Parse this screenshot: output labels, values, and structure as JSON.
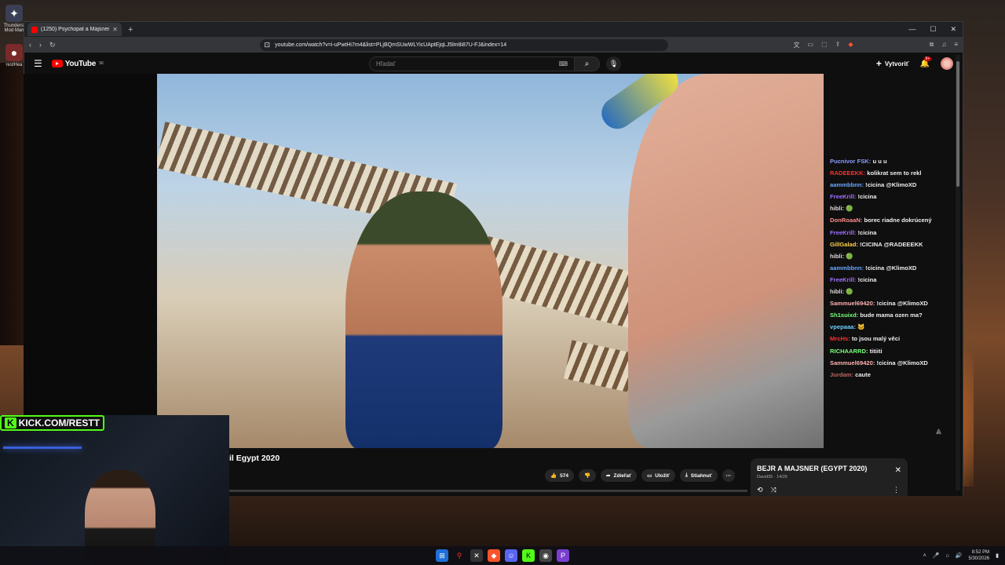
{
  "desktop": {
    "icons": [
      {
        "label": "Thunderst Mod Man",
        "glyph": "✦"
      },
      {
        "label": "restHea",
        "glyph": "●"
      }
    ]
  },
  "browser": {
    "tab_title": "(1250) Psychopat a Majsner",
    "url": "youtube.com/watch?v=i-uPwtHi7m4&list=PLjBQmSUwWLYicUAptEjqLJ5lm8i87U-FJ&index=14"
  },
  "youtube": {
    "logo_text": "YouTube",
    "logo_sup": "SK",
    "search_placeholder": "Hľadať",
    "create_label": "Vytvoriť",
    "notif_count": "9+"
  },
  "chat": [
    {
      "user": "Pucnivor FSK:",
      "user_color": "#8a9cff",
      "msg": "u u u"
    },
    {
      "user": "RADEEEKK:",
      "user_color": "#ff3030",
      "msg": "kolikrat sem to rekl"
    },
    {
      "user": "aammbbnn:",
      "user_color": "#6aa8ff",
      "msg": "!cicina @KlimoXD"
    },
    {
      "user": "FreeKrill:",
      "user_color": "#a070ff",
      "msg": "!cicina"
    },
    {
      "user": "hibli:",
      "user_color": "#dddddd",
      "msg": "🟢"
    },
    {
      "user": "DonRoaaN:",
      "user_color": "#ff8a8a",
      "msg": "borec riadne dokrúcený"
    },
    {
      "user": "FreeKrill:",
      "user_color": "#a070ff",
      "msg": "!cicina"
    },
    {
      "user": "GillGalad:",
      "user_color": "#ffd24a",
      "msg": "!CICINA @RADEEEKK"
    },
    {
      "user": "hibli:",
      "user_color": "#dddddd",
      "msg": "🟢"
    },
    {
      "user": "aammbbnn:",
      "user_color": "#6aa8ff",
      "msg": "!cicina @KlimoXD"
    },
    {
      "user": "FreeKrill:",
      "user_color": "#a070ff",
      "msg": "!cicina"
    },
    {
      "user": "hibli:",
      "user_color": "#dddddd",
      "msg": "🟢"
    },
    {
      "user": "Sammuel69420:",
      "user_color": "#ffb0b0",
      "msg": "!cicina @KlimoXD"
    },
    {
      "user": "Sh1suixd:",
      "user_color": "#7aff7a",
      "msg": "bude mama ozen ma?"
    },
    {
      "user": "vpepaaa:",
      "user_color": "#6ad0ff",
      "msg": "🐱"
    },
    {
      "user": "MrcHs:",
      "user_color": "#ff3030",
      "msg": "to jsou malý věci"
    },
    {
      "user": "RICHAARRD:",
      "user_color": "#7aff7a",
      "msg": "titiiti"
    },
    {
      "user": "Sammuel69420:",
      "user_color": "#ffb0b0",
      "msg": "!cicina @KlimoXD"
    },
    {
      "user": "Jurdam:",
      "user_color": "#bb6666",
      "msg": "caute"
    }
  ],
  "video": {
    "title_partial": "il Egypt 2020",
    "like_count": "574",
    "share_label": "Zdieľať",
    "save_label": "Uložiť",
    "download_label": "Stiahnuť"
  },
  "playlist": {
    "title": "BEJR A MAJSNER (EGYPT 2020)",
    "subtitle": "David35 · 14/26"
  },
  "overlay": {
    "kick_banner": "KICK.COM/RESTT"
  },
  "taskbar": {
    "time": "8:52 PM",
    "date": "5/30/2026"
  }
}
